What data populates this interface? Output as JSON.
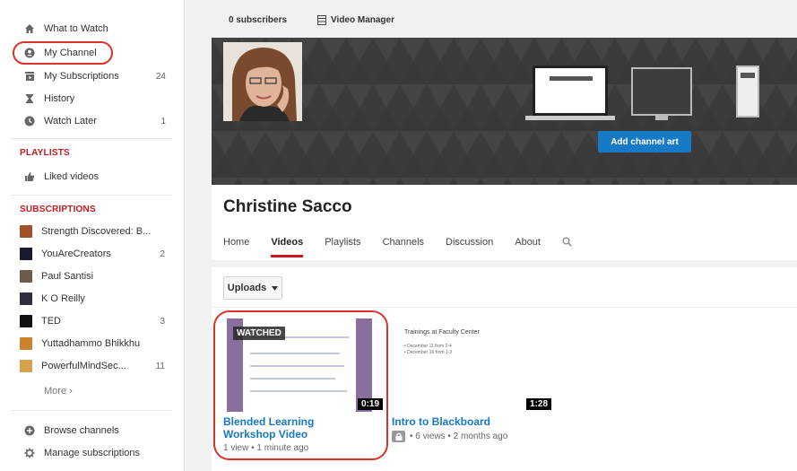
{
  "sidebar": {
    "nav": [
      {
        "label": "What to Watch",
        "icon": "home-icon",
        "count": ""
      },
      {
        "label": "My Channel",
        "icon": "user-icon",
        "count": ""
      },
      {
        "label": "My Subscriptions",
        "icon": "subscriptions-icon",
        "count": "24"
      },
      {
        "label": "History",
        "icon": "hourglass-icon",
        "count": ""
      },
      {
        "label": "Watch Later",
        "icon": "clock-icon",
        "count": "1"
      }
    ],
    "playlists_heading": "PLAYLISTS",
    "liked_videos": "Liked videos",
    "subscriptions_heading": "SUBSCRIPTIONS",
    "subscriptions": [
      {
        "name": "Strength Discovered: B...",
        "count": "",
        "color": "#a0522d"
      },
      {
        "name": "YouAreCreators",
        "count": "2",
        "color": "#1a1a2e"
      },
      {
        "name": "Paul Santisi",
        "count": "",
        "color": "#6b5b4b"
      },
      {
        "name": "K O Reilly",
        "count": "",
        "color": "#2e2e3e"
      },
      {
        "name": "TED",
        "count": "3",
        "color": "#111111"
      },
      {
        "name": "Yuttadhammo Bhikkhu",
        "count": "",
        "color": "#c9822f"
      },
      {
        "name": "PowerfulMindSec...",
        "count": "11",
        "color": "#d4a24a"
      }
    ],
    "more": "More ›",
    "browse_channels": "Browse channels",
    "manage_subscriptions": "Manage subscriptions"
  },
  "topbar": {
    "subscribers": "0 subscribers",
    "video_manager": "Video Manager"
  },
  "banner": {
    "add_art": "Add channel art"
  },
  "channel": {
    "name": "Christine Sacco",
    "tabs": [
      "Home",
      "Videos",
      "Playlists",
      "Channels",
      "Discussion",
      "About"
    ]
  },
  "uploads": {
    "label": "Uploads"
  },
  "videos": [
    {
      "title_line1": "Blended Learning",
      "title_line2": "Workshop Video",
      "meta": "1 view • 1 minute ago",
      "duration": "0:19",
      "watched": "WATCHED"
    },
    {
      "title_line1": "Intro to Blackboard",
      "title_line2": "",
      "meta": "• 6 views • 2 months ago",
      "duration": "1:28",
      "thumb_heading": "Trainings at Faculty Center",
      "thumb_line1": "• December 11 from 2-4",
      "thumb_line2": "• December 16 from 1-3"
    }
  ],
  "colors": {
    "accent_red": "#cc181e",
    "link_blue": "#167ac6",
    "highlight_oval": "#d9342b"
  }
}
